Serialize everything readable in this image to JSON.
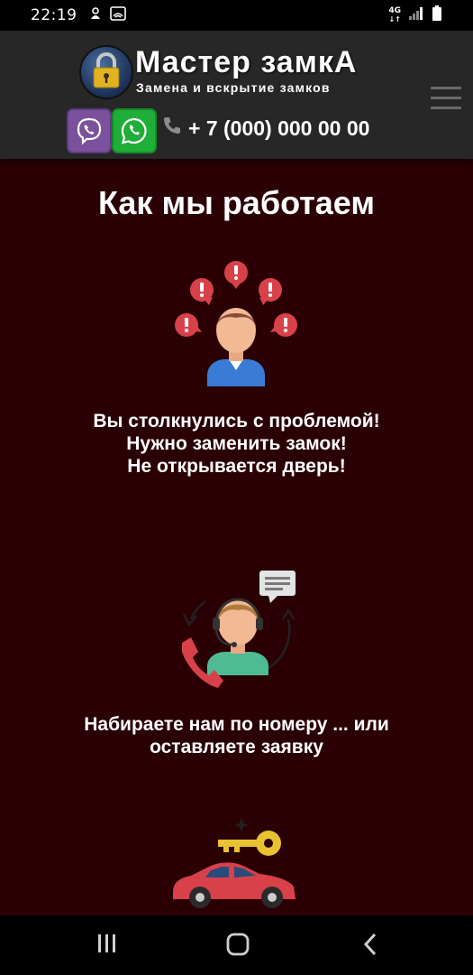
{
  "status_bar": {
    "time": "22:19",
    "network": "4G"
  },
  "header": {
    "title": "Мастер замкА",
    "subtitle": "Замена и вскрытие замков",
    "phone": "+ 7 (000) 000 00 00",
    "icons": [
      "lock-logo",
      "viber-icon",
      "whatsapp-icon",
      "phone-icon",
      "menu-icon"
    ]
  },
  "section": {
    "title": "Как мы работаем",
    "steps": [
      {
        "icon": "person-problem-icon",
        "lines": [
          "Вы столкнулись с проблемой!",
          "Нужно заменить замок!",
          "Не открывается дверь!"
        ]
      },
      {
        "icon": "operator-call-icon",
        "lines": [
          "Набираете нам по номеру ... или",
          "оставляете заявку"
        ]
      },
      {
        "icon": "car-key-icon",
        "lines": []
      }
    ]
  },
  "colors": {
    "page_bg": "#2a0005",
    "header_bg": "#272727",
    "accent_red": "#d9414a",
    "viber": "#7b519d",
    "whatsapp": "#1fae38"
  }
}
